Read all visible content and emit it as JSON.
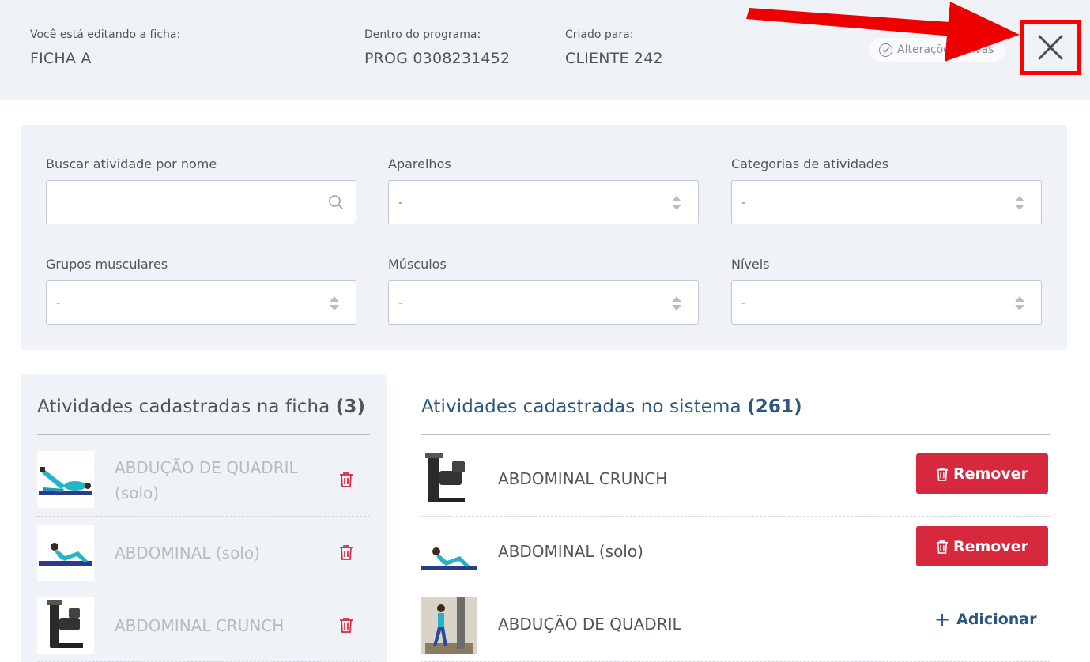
{
  "header": {
    "editing_label": "Você está editando a ficha:",
    "editing_value": "FICHA A",
    "program_label": "Dentro do programa:",
    "program_value": "PROG 0308231452",
    "created_label": "Criado para:",
    "created_value": "CLIENTE 242",
    "saved_badge": "Alterações salvas"
  },
  "filters": {
    "search_label": "Buscar atividade por nome",
    "search_value": "",
    "devices_label": "Aparelhos",
    "devices_value": "-",
    "categories_label": "Categorias de atividades",
    "categories_value": "-",
    "muscle_groups_label": "Grupos musculares",
    "muscle_groups_value": "-",
    "muscles_label": "Músculos",
    "muscles_value": "-",
    "levels_label": "Níveis",
    "levels_value": "-"
  },
  "sheet": {
    "title": "Atividades cadastradas na ficha",
    "count": "(3)",
    "items": [
      {
        "line1": "ABDUÇÃO DE QUADRIL",
        "line2": "(solo)"
      },
      {
        "line1": "ABDOMINAL (solo)",
        "line2": ""
      },
      {
        "line1": "ABDOMINAL CRUNCH",
        "line2": ""
      }
    ]
  },
  "system": {
    "title": "Atividades cadastradas no sistema",
    "count": "(261)",
    "remove_label": "Remover",
    "add_label": "Adicionar",
    "items": [
      {
        "name": "ABDOMINAL CRUNCH"
      },
      {
        "name": "ABDOMINAL (solo)"
      },
      {
        "name": "ABDUÇÃO DE QUADRIL"
      }
    ]
  },
  "colors": {
    "accent_blue": "#2d5780",
    "danger_red": "#d6293e",
    "highlight_red": "#ff0000",
    "panel_bg": "#eff2f7"
  },
  "icons": [
    "check-circle-icon",
    "close-icon",
    "search-icon",
    "updown-icon",
    "trash-icon",
    "plus-icon",
    "arrow-annotation"
  ]
}
